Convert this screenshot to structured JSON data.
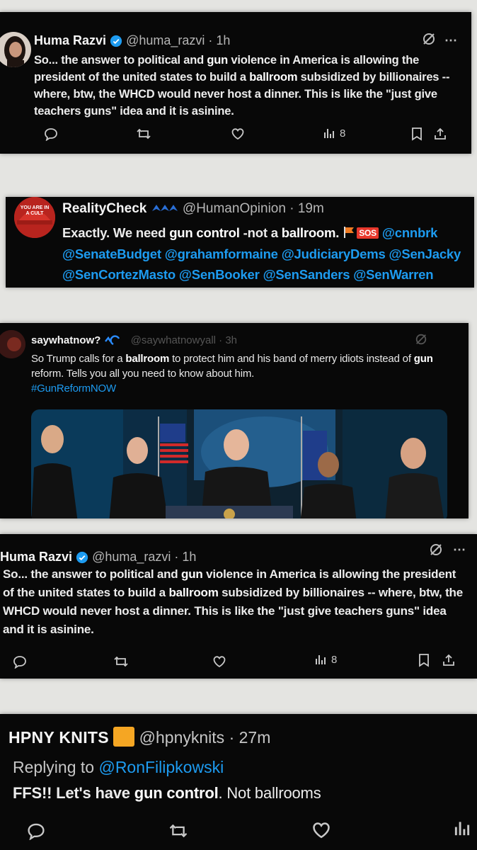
{
  "post1": {
    "name": "Huma Razvi",
    "handle": "@huma_razvi",
    "time": "· 1h",
    "text_parts": [
      "So... the answer to political and ",
      "gun",
      " violence in America is allowing the president of the united states to build a ",
      "ballroom",
      " subsidized by billionaires -- where, btw, the WHCD would never host a dinner. This is like the \"just give teachers guns\" idea and it is asinine."
    ],
    "views": "8"
  },
  "post2": {
    "name": "RealityCheck",
    "handle": "@HumanOpinion",
    "time": "· 19m",
    "avatar_text": "YOU ARE IN A CULT",
    "text_a": "Exactly. We need ",
    "text_b": "gun control",
    "text_c": " -not a ",
    "text_d": "ballroom.",
    "sos_badge": "SOS",
    "mentions_line1": "@cnnbrk",
    "mentions_line2": "@SenateBudget @grahamformaine @JudiciaryDems @SenJacky",
    "mentions_line3": "@SenCortezMasto @SenBooker @SenSanders @SenWarren"
  },
  "post3": {
    "name": "saywhatnow?",
    "handle": "@saywhatnowyall",
    "time": "· 3h",
    "text_parts": [
      "So Trump calls for a ",
      "ballroom",
      " to protect him and his band of merry idiots instead of ",
      "gun",
      " reform. Tells you all you need to know about him."
    ],
    "hashtag": "#GunReformNOW"
  },
  "post4": {
    "name": "Huma Razvi",
    "handle": "@huma_razvi",
    "time": "· 1h",
    "text_parts": [
      "So... the answer to political and ",
      "gun",
      " violence in America is allowing the president of the united states to build a ",
      "ballroom",
      " subsidized by billionaires -- where, btw, the WHCD would never host a dinner. This is like the \"just give teachers guns\" idea and it is asinine."
    ],
    "views": "8"
  },
  "post5": {
    "name": "HPNY KNITS",
    "handle": "@hpnyknits",
    "time": "· 27m",
    "replying_prefix": "Replying to ",
    "replying_to": "@RonFilipkowski",
    "text_a": "FFS!! Let's have ",
    "text_b": "gun control",
    "text_c": ". Not ballrooms"
  },
  "colors": {
    "accent": "#1d9bf0",
    "card_bg": "#080808",
    "badge_orange": "#f5a623",
    "sos_red": "#e8372b"
  }
}
